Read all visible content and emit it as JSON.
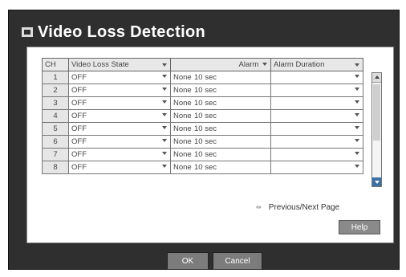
{
  "window": {
    "title": "Video Loss Detection"
  },
  "table": {
    "headers": {
      "ch": "CH",
      "state": "Video Loss State",
      "alarm": "Alarm",
      "duration": "Alarm Duration"
    },
    "rows": [
      {
        "ch": "1",
        "state": "OFF",
        "alarm": "None",
        "duration": "10 sec"
      },
      {
        "ch": "2",
        "state": "OFF",
        "alarm": "None",
        "duration": "10 sec"
      },
      {
        "ch": "3",
        "state": "OFF",
        "alarm": "None",
        "duration": "10 sec"
      },
      {
        "ch": "4",
        "state": "OFF",
        "alarm": "None",
        "duration": "10 sec"
      },
      {
        "ch": "5",
        "state": "OFF",
        "alarm": "None",
        "duration": "10 sec"
      },
      {
        "ch": "6",
        "state": "OFF",
        "alarm": "None",
        "duration": "10 sec"
      },
      {
        "ch": "7",
        "state": "OFF",
        "alarm": "None",
        "duration": "10 sec"
      },
      {
        "ch": "8",
        "state": "OFF",
        "alarm": "None",
        "duration": "10 sec"
      }
    ]
  },
  "pager": {
    "icon": "«»",
    "label": "Previous/Next Page"
  },
  "buttons": {
    "help": "Help",
    "ok": "OK",
    "cancel": "Cancel"
  },
  "colors": {
    "frame": "#2f2f2f",
    "panel": "#ffffff",
    "button": "#7c7c7c",
    "scroll_accent": "#3c6fa8"
  }
}
